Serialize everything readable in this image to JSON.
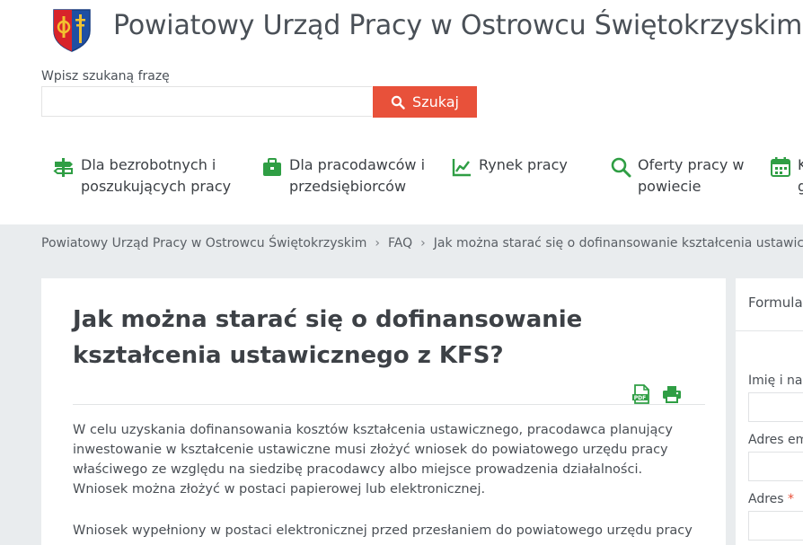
{
  "site": {
    "title": "Powiatowy Urząd Pracy w Ostrowcu Świętokrzyskim",
    "crest_icon": "coat-of-arms-icon"
  },
  "search": {
    "label": "Wpisz szukaną frazę",
    "value": "",
    "placeholder": "",
    "button_label": "Szukaj",
    "button_color": "#e8513a"
  },
  "nav": {
    "items": [
      {
        "label": "Dla bezrobotnych i\nposzukujących pracy",
        "icon": "signpost-icon"
      },
      {
        "label": "Dla pracodawców i\nprzedsiębiorców",
        "icon": "briefcase-icon"
      },
      {
        "label": "Rynek pracy",
        "icon": "chart-line-icon"
      },
      {
        "label": "Oferty pracy w\npowiecie",
        "icon": "search-icon"
      },
      {
        "label": "K\ng",
        "icon": "calendar-icon"
      }
    ],
    "icon_color": "#2f9e44"
  },
  "breadcrumb": {
    "items": [
      "Powiatowy Urząd Pracy w Ostrowcu Świętokrzyskim",
      "FAQ",
      "Jak można starać się o dofinansowanie kształcenia ustawiczn"
    ],
    "separator": "›"
  },
  "article": {
    "title": "Jak można starać się o dofinansowanie kształcenia ustawicznego z KFS?",
    "tools": [
      {
        "name": "pdf-icon",
        "color": "#2f9e44"
      },
      {
        "name": "print-icon",
        "color": "#2f9e44"
      }
    ],
    "paragraphs": [
      "W celu uzyskania dofinansowania kosztów kształcenia ustawicznego, pracodawca planujący inwestowanie w kształcenie ustawiczne musi złożyć wniosek do powiatowego urzędu pracy właściwego ze względu na siedzibę pracodawcy albo miejsce prowadzenia działalności. Wniosek można złożyć w postaci papierowej lub elektronicznej.",
      "Wniosek wypełniony w postaci elektronicznej przed przesłaniem do powiatowego urzędu pracy"
    ]
  },
  "sidebar": {
    "heading": "Formula",
    "fields": [
      {
        "label": "Imię i naz",
        "required": false,
        "value": ""
      },
      {
        "label": "Adres em",
        "required": false,
        "value": ""
      },
      {
        "label": "Adres",
        "required": true,
        "value": ""
      }
    ],
    "required_mark": "*"
  }
}
